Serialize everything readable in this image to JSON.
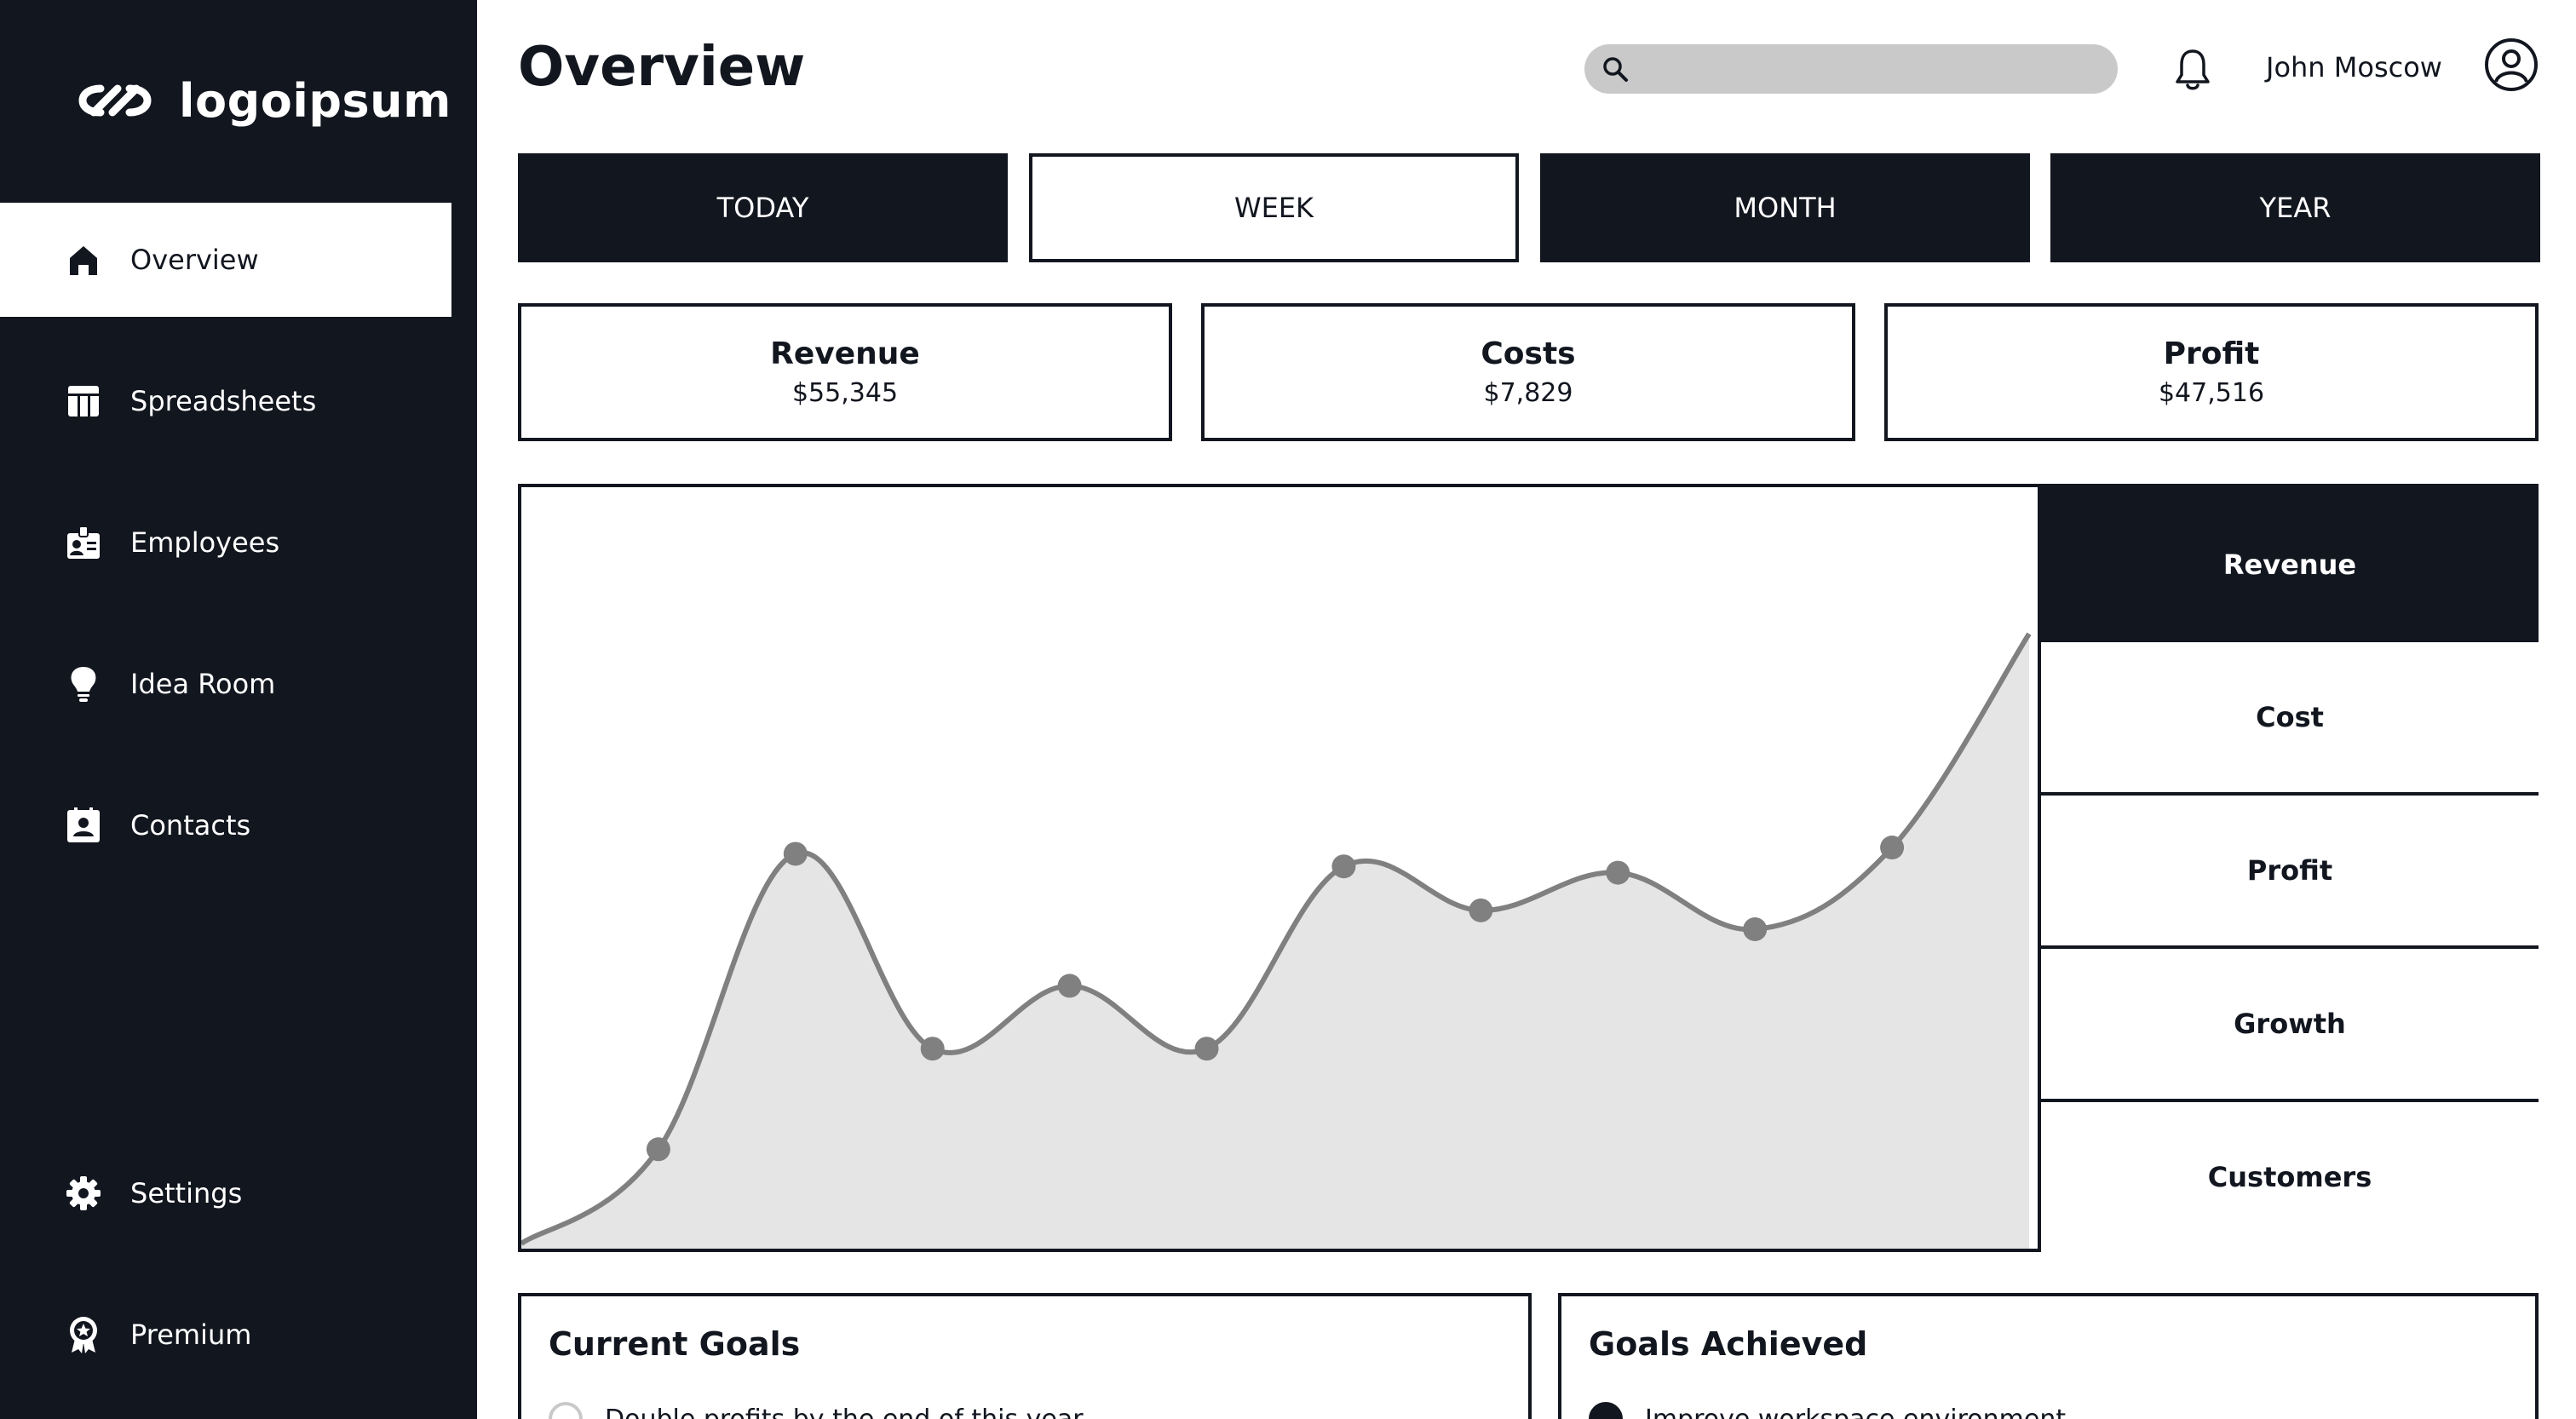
{
  "brand": {
    "name": "logoipsum",
    "logo_icon": "infinity-logo-icon"
  },
  "sidebar": {
    "items": [
      {
        "label": "Overview",
        "icon": "home-icon",
        "active": true
      },
      {
        "label": "Spreadsheets",
        "icon": "table-icon",
        "active": false
      },
      {
        "label": "Employees",
        "icon": "id-badge-icon",
        "active": false
      },
      {
        "label": "Idea Room",
        "icon": "lightbulb-icon",
        "active": false
      },
      {
        "label": "Contacts",
        "icon": "contact-card-icon",
        "active": false
      }
    ],
    "bottom_items": [
      {
        "label": "Settings",
        "icon": "gear-icon"
      },
      {
        "label": "Premium",
        "icon": "award-icon"
      }
    ]
  },
  "header": {
    "title": "Overview",
    "search_placeholder": "",
    "user_name": "John Moscow"
  },
  "period_tabs": [
    {
      "label": "TODAY",
      "active": false
    },
    {
      "label": "WEEK",
      "active": true
    },
    {
      "label": "MONTH",
      "active": false
    },
    {
      "label": "YEAR",
      "active": false
    }
  ],
  "stats": [
    {
      "title": "Revenue",
      "value": "$55,345"
    },
    {
      "title": "Costs",
      "value": "$7,829"
    },
    {
      "title": "Profit",
      "value": "$47,516"
    }
  ],
  "metrics": [
    {
      "label": "Revenue",
      "active": true
    },
    {
      "label": "Cost",
      "active": false
    },
    {
      "label": "Profit",
      "active": false
    },
    {
      "label": "Growth",
      "active": false
    },
    {
      "label": "Customers",
      "active": false
    }
  ],
  "chart_data": {
    "type": "area",
    "title": "",
    "xlabel": "",
    "ylabel": "",
    "x": [
      0,
      1,
      2,
      3,
      4,
      5,
      6,
      7,
      8,
      9,
      10,
      11
    ],
    "values": [
      0,
      15,
      62,
      31,
      41,
      31,
      60,
      53,
      59,
      50,
      63,
      97
    ],
    "ylim": [
      0,
      100
    ],
    "grid": false,
    "colors": {
      "line": "#808080",
      "fill": "#e5e5e5"
    }
  },
  "goals": {
    "current": {
      "title": "Current Goals",
      "items": [
        {
          "text": "Double profits by the end of this year",
          "done": false
        }
      ]
    },
    "achieved": {
      "title": "Goals Achieved",
      "items": [
        {
          "text": "Improve workspace environment",
          "done": true
        }
      ]
    }
  },
  "colors": {
    "dark": "#12161f",
    "search_bg": "#c9c9c9",
    "line": "#808080",
    "fill": "#e5e5e5"
  }
}
